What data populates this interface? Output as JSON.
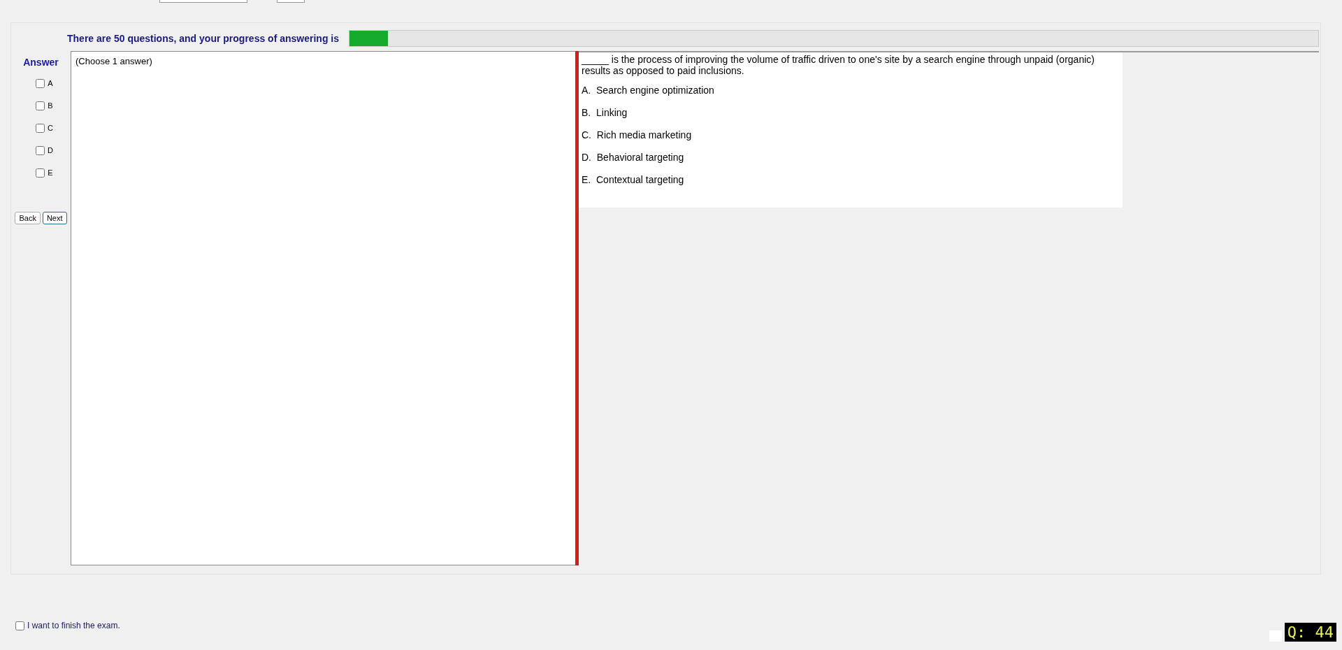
{
  "progress": {
    "label": "There are 50 questions, and your progress of answering is",
    "level": 0.04
  },
  "answer_panel": {
    "title": "Answer",
    "options": [
      {
        "label": "A",
        "checked": false
      },
      {
        "label": "B",
        "checked": false
      },
      {
        "label": "C",
        "checked": false
      },
      {
        "label": "D",
        "checked": false
      },
      {
        "label": "E",
        "checked": false
      }
    ],
    "buttons": [
      {
        "label": "Back",
        "selected": false
      },
      {
        "label": "Next",
        "selected": true
      }
    ]
  },
  "instruction": "(Choose 1 answer)",
  "question": {
    "text": "_____ is the process of improving the volume of traffic driven to one's site by a search engine through unpaid (organic) results as opposed to paid inclusions.",
    "choices": [
      "A.  Search engine optimization",
      "B.  Linking",
      "C.  Rich media marketing",
      "D.  Behavioral targeting",
      "E.  Contextual targeting"
    ]
  },
  "finish": {
    "label": "I want to finish the exam.",
    "checked": false
  },
  "question_number": "Q: 44"
}
